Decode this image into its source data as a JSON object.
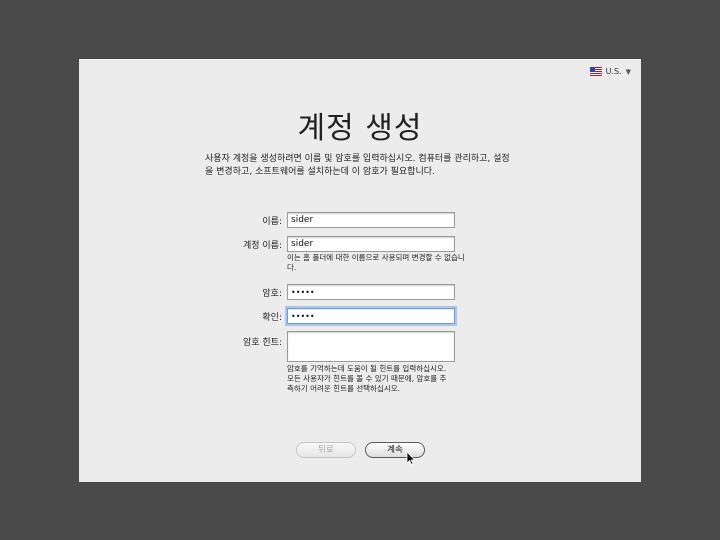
{
  "locale": {
    "label": "U.S.",
    "icon": "us-flag-icon"
  },
  "title": "계정 생성",
  "description": "사용자 계정을 생성하려면 이름 및 암호를 입력하십시오. 컴퓨터를 관리하고, 설정을 변경하고, 소프트웨어를 설치하는데 이 암호가 필요합니다.",
  "form": {
    "name_label": "이름:",
    "name_value": "sider",
    "account_label": "계정 이름:",
    "account_value": "sider",
    "account_help": "이는 홈 폴더에 대한 이름으로 사용되며 변경할 수 없습니다.",
    "password_label": "암호:",
    "password_value": "•••••",
    "verify_label": "확인:",
    "verify_value": "•••••",
    "hint_label": "암호 힌트:",
    "hint_value": "",
    "hint_help": "암호를 기억하는데 도움이 될 힌트를 입력하십시오. 모든 사용자가 힌트를 볼 수 있기 때문에, 암호를 추측하기 어려운 힌트를 선택하십시오."
  },
  "buttons": {
    "back": "뒤로",
    "continue": "계속"
  }
}
